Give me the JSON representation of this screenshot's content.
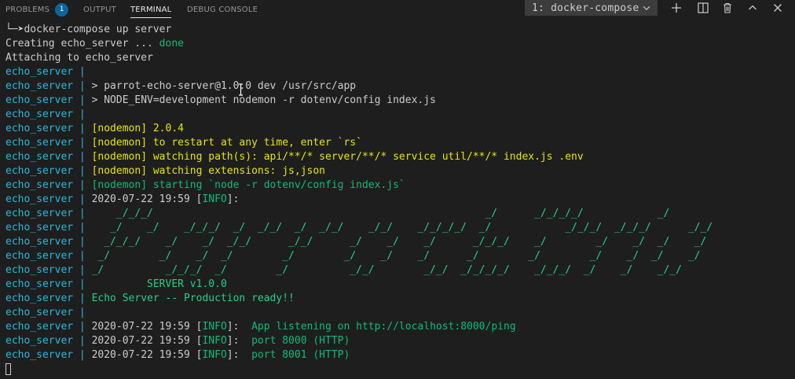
{
  "panel": {
    "tabs": [
      {
        "label": "PROBLEMS",
        "badge": "1"
      },
      {
        "label": "OUTPUT"
      },
      {
        "label": "TERMINAL"
      },
      {
        "label": "DEBUG CONSOLE"
      }
    ],
    "active_tab": "TERMINAL",
    "terminal_select": {
      "value": "1: docker-compose"
    },
    "actions": [
      "plus-icon",
      "split-icon",
      "trash-icon",
      "chevron-up-icon",
      "close-icon"
    ]
  },
  "colors": {
    "prefix": "#29b8db",
    "green": "#23d18b",
    "dark_green": "#0dbc79",
    "yellow": "#e5e510",
    "text": "#cccccc",
    "background": "#1e1e1e"
  },
  "terminal": {
    "prefix": "echo_server | ",
    "lines": [
      [
        {
          "t": "└─➤docker-compose up server",
          "c": "white"
        }
      ],
      [
        {
          "t": "Creating echo_server ... ",
          "c": "white"
        },
        {
          "t": "done",
          "c": "dgreen"
        }
      ],
      [
        {
          "t": "Attaching to echo_server",
          "c": "white"
        }
      ],
      [
        {
          "t": "echo_server |",
          "c": "cyan"
        }
      ],
      [
        {
          "t": "echo_server | ",
          "c": "cyan"
        },
        {
          "t": "> parrot-echo-server@1.0.0 dev /usr/src/app",
          "c": "white"
        }
      ],
      [
        {
          "t": "echo_server | ",
          "c": "cyan"
        },
        {
          "t": "> NODE_ENV=development nodemon -r dotenv/config index.js",
          "c": "white"
        }
      ],
      [
        {
          "t": "echo_server |",
          "c": "cyan"
        }
      ],
      [
        {
          "t": "echo_server | ",
          "c": "cyan"
        },
        {
          "t": "[nodemon] 2.0.4",
          "c": "yellow"
        }
      ],
      [
        {
          "t": "echo_server | ",
          "c": "cyan"
        },
        {
          "t": "[nodemon] to restart at any time, enter `rs`",
          "c": "yellow"
        }
      ],
      [
        {
          "t": "echo_server | ",
          "c": "cyan"
        },
        {
          "t": "[nodemon] watching path(s): api/**/* server/**/* service util/**/* index.js .env",
          "c": "yellow"
        }
      ],
      [
        {
          "t": "echo_server | ",
          "c": "cyan"
        },
        {
          "t": "[nodemon] watching extensions: js,json",
          "c": "yellow"
        }
      ],
      [
        {
          "t": "echo_server | ",
          "c": "cyan"
        },
        {
          "t": "[nodemon] starting `node -r dotenv/config index.js`",
          "c": "dgreen"
        }
      ],
      [
        {
          "t": "echo_server | ",
          "c": "cyan"
        },
        {
          "t": "2020-07-22 19:59 [",
          "c": "white"
        },
        {
          "t": "INFO",
          "c": "dgreen"
        },
        {
          "t": "]:",
          "c": "white"
        }
      ],
      [
        {
          "t": "echo_server | ",
          "c": "cyan"
        },
        {
          "t": "    _/_/_/                                                      _/      _/_/_/_/            _/",
          "c": "green"
        }
      ],
      [
        {
          "t": "echo_server | ",
          "c": "cyan"
        },
        {
          "t": "   _/    _/    _/_/_/  _/  _/_/  _/  _/_/    _/_/    _/_/_/_/  _/            _/_/_/  _/_/_/      _/_/",
          "c": "green"
        }
      ],
      [
        {
          "t": "echo_server | ",
          "c": "cyan"
        },
        {
          "t": "  _/_/_/    _/    _/  _/_/      _/_/      _/    _/    _/      _/_/_/    _/        _/    _/  _/    _/",
          "c": "green"
        }
      ],
      [
        {
          "t": "echo_server | ",
          "c": "cyan"
        },
        {
          "t": " _/        _/    _/  _/        _/        _/    _/    _/      _/        _/        _/    _/  _/    _/",
          "c": "green"
        }
      ],
      [
        {
          "t": "echo_server | ",
          "c": "cyan"
        },
        {
          "t": "_/          _/_/_/  _/        _/          _/_/        _/_/  _/_/_/_/    _/_/_/  _/    _/    _/_/",
          "c": "green"
        }
      ],
      [
        {
          "t": "echo_server | ",
          "c": "cyan"
        },
        {
          "t": "         SERVER v1.0.0",
          "c": "green"
        }
      ],
      [
        {
          "t": "echo_server | ",
          "c": "cyan"
        },
        {
          "t": "Echo Server -- Production ready!!",
          "c": "green"
        }
      ],
      [
        {
          "t": "echo_server |",
          "c": "cyan"
        }
      ],
      [
        {
          "t": "echo_server | ",
          "c": "cyan"
        },
        {
          "t": "2020-07-22 19:59 [",
          "c": "white"
        },
        {
          "t": "INFO",
          "c": "dgreen"
        },
        {
          "t": "]:  ",
          "c": "white"
        },
        {
          "t": "App listening on http://localhost:8000/ping",
          "c": "dgreen"
        }
      ],
      [
        {
          "t": "echo_server | ",
          "c": "cyan"
        },
        {
          "t": "2020-07-22 19:59 [",
          "c": "white"
        },
        {
          "t": "INFO",
          "c": "dgreen"
        },
        {
          "t": "]:  ",
          "c": "white"
        },
        {
          "t": "port 8000 (HTTP)",
          "c": "dgreen"
        }
      ],
      [
        {
          "t": "echo_server | ",
          "c": "cyan"
        },
        {
          "t": "2020-07-22 19:59 [",
          "c": "white"
        },
        {
          "t": "INFO",
          "c": "dgreen"
        },
        {
          "t": "]:  ",
          "c": "white"
        },
        {
          "t": "port 8001 (HTTP)",
          "c": "dgreen"
        }
      ],
      []
    ]
  }
}
